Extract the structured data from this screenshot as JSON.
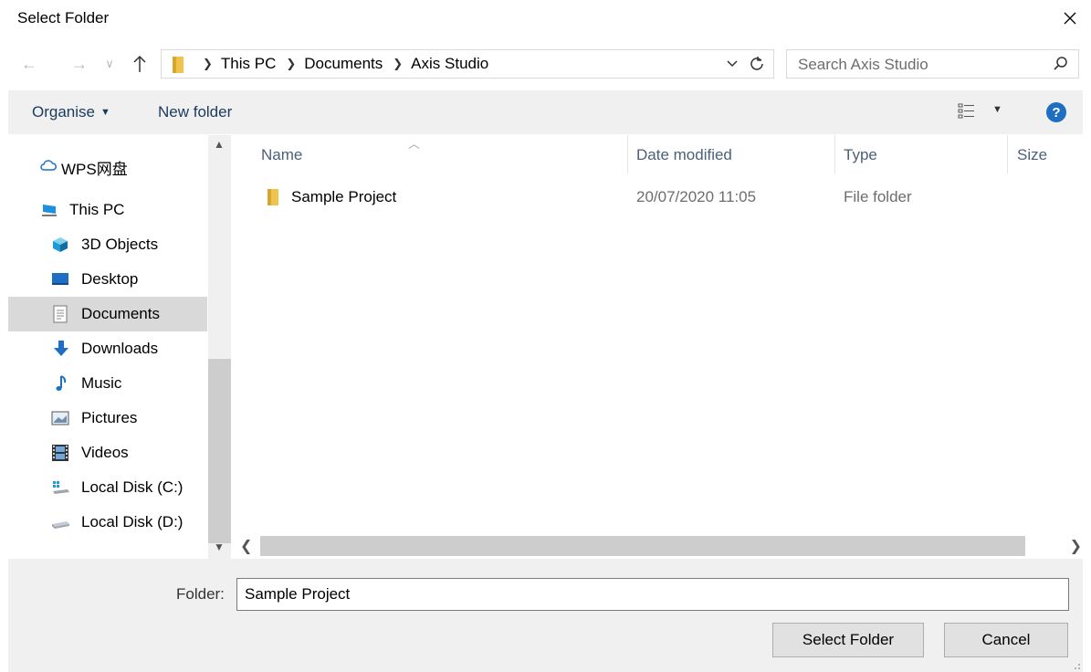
{
  "window": {
    "title": "Select Folder",
    "close_icon": "close-icon"
  },
  "nav": {
    "breadcrumbs": [
      "This PC",
      "Documents",
      "Axis Studio"
    ],
    "search_placeholder": "Search Axis Studio"
  },
  "toolbar": {
    "organise_label": "Organise",
    "new_folder_label": "New folder"
  },
  "sidebar": {
    "items": [
      {
        "label": "WPS网盘",
        "icon": "cloud-icon",
        "selected": false
      },
      {
        "label": "This PC",
        "icon": "computer-icon",
        "selected": false
      },
      {
        "label": "3D Objects",
        "icon": "3d-objects-icon",
        "selected": false
      },
      {
        "label": "Desktop",
        "icon": "desktop-icon",
        "selected": false
      },
      {
        "label": "Documents",
        "icon": "documents-icon",
        "selected": true
      },
      {
        "label": "Downloads",
        "icon": "downloads-icon",
        "selected": false
      },
      {
        "label": "Music",
        "icon": "music-icon",
        "selected": false
      },
      {
        "label": "Pictures",
        "icon": "pictures-icon",
        "selected": false
      },
      {
        "label": "Videos",
        "icon": "videos-icon",
        "selected": false
      },
      {
        "label": "Local Disk (C:)",
        "icon": "windows-drive-icon",
        "selected": false
      },
      {
        "label": "Local Disk (D:)",
        "icon": "drive-icon",
        "selected": false
      }
    ]
  },
  "table": {
    "columns": [
      "Name",
      "Date modified",
      "Type",
      "Size"
    ],
    "rows": [
      {
        "name": "Sample Project",
        "date": "20/07/2020 11:05",
        "type": "File folder",
        "size": ""
      }
    ]
  },
  "footer": {
    "folder_label": "Folder:",
    "folder_value": "Sample Project",
    "select_button": "Select Folder",
    "cancel_button": "Cancel"
  },
  "colors": {
    "accent": "#1e6fc4",
    "folder": "#f0c44c",
    "selection": "#d9d9d9",
    "toolbar_bg": "#f0f0f0"
  }
}
